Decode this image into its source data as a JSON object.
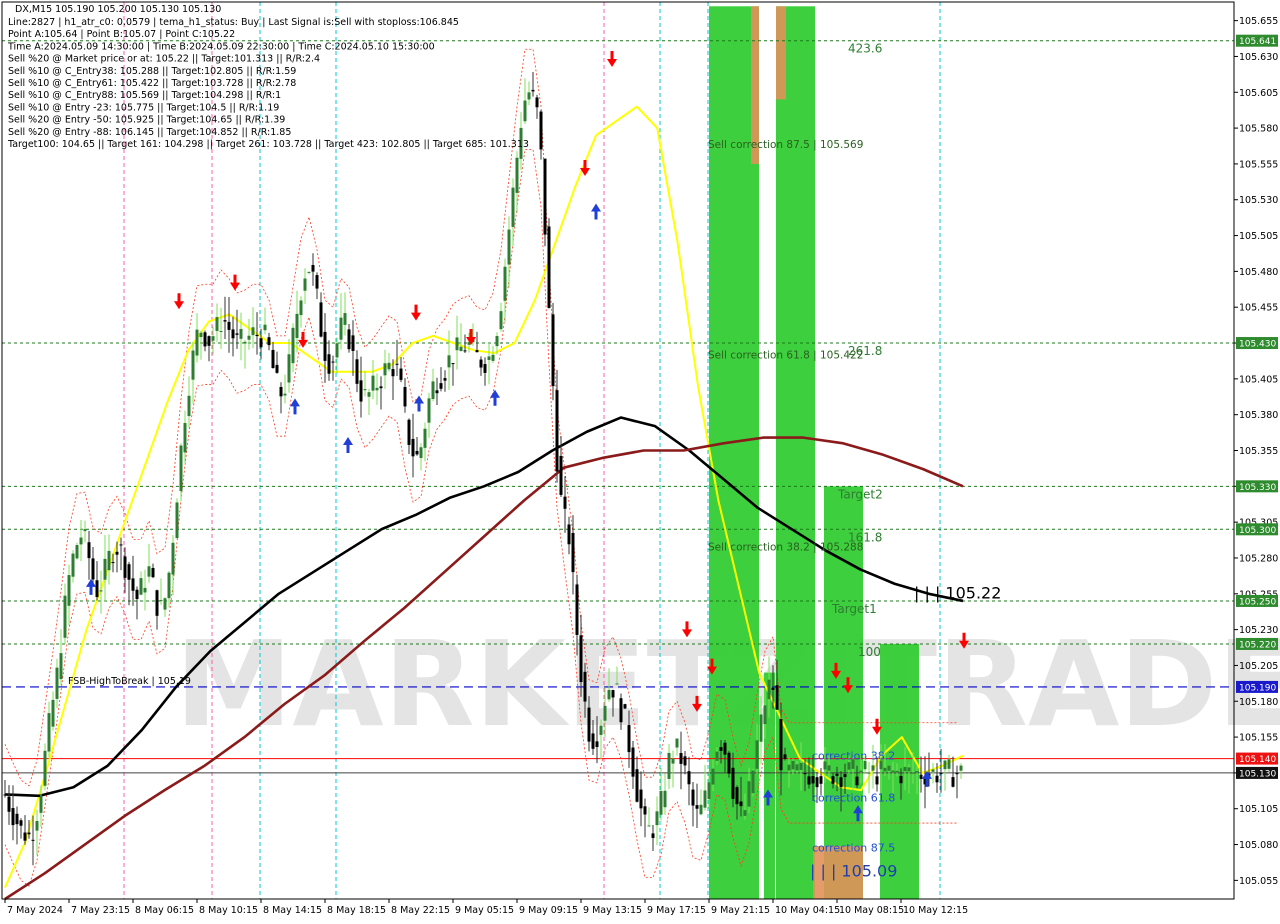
{
  "chart_title": "DX,M15  105.190 105.200 105.130 105.130",
  "info_lines": [
    "Line:2827 | h1_atr_c0: 0.0579 | tema_h1_status: Buy | Last Signal is:Sell with stoploss:106.845",
    "Point A:105.64 | Point B:105.07 | Point C:105.22",
    "Time A:2024.05.09 14:30:00 | Time B:2024.05.09 22:30:00 | Time C:2024.05.10 15:30:00",
    "Sell %20 @ Market price or at: 105.22 || Target:101.313 || R/R:2.4",
    "Sell %10 @ C_Entry38: 105.288 || Target:102.805 || R/R:1.59",
    "Sell %10 @ C_Entry61: 105.422 || Target:103.728 || R/R:2.78",
    "Sell %10 @ C_Entry88: 105.569 || Target:104.298 || R/R:1",
    "Sell %10 @ Entry -23: 105.775 || Target:104.5 || R/R:1.19",
    "Sell %20 @ Entry -50: 105.925 || Target:104.65 || R/R:1.39",
    "Sell %20 @ Entry -88: 106.145 || Target:104.852 || R/R:1.85",
    "Target100: 104.65 || Target 161: 104.298 || Target 261: 103.728 || Target 423: 102.805 || Target 685: 101.313"
  ],
  "watermark": "MARKETZITRADE",
  "colors": {
    "background": "#ffffff",
    "plot_background": "#d9d9d9",
    "bull_candle": "#2e7d32",
    "bear_candle": "#000000",
    "wick_green": "#7ee05a",
    "tema_yellow": "#ffff00",
    "ma_black": "#000000",
    "ma_darkred": "#8b1a1a",
    "envelope_red": "#ff3b1f",
    "zone_green": "#33cc33",
    "zone_orange": "#e0915a",
    "level_green": "#1b7a1b",
    "fsb_blue": "#0000cc",
    "current_red": "#ff0000",
    "current_gray": "#808080",
    "vline_cyan": "#00c8d7",
    "vline_pink": "#ff5ca8"
  },
  "chart_data": {
    "type": "candlestick",
    "symbol": "DX",
    "timeframe": "M15",
    "ohlc_last": {
      "open": 105.19,
      "high": 105.2,
      "low": 105.13,
      "close": 105.13
    },
    "y_range": [
      105.042,
      105.668
    ],
    "y_ticks": [
      "105.655",
      "105.630",
      "105.605",
      "105.580",
      "105.555",
      "105.530",
      "105.505",
      "105.480",
      "105.455",
      "105.430",
      "105.405",
      "105.380",
      "105.355",
      "105.330",
      "105.305",
      "105.280",
      "105.255",
      "105.230",
      "105.205",
      "105.180",
      "105.155",
      "105.130",
      "105.105",
      "105.080",
      "105.055"
    ],
    "x_ticks": [
      "7 May 2024",
      "7 May 23:15",
      "8 May 06:15",
      "8 May 10:15",
      "8 May 14:15",
      "8 May 18:15",
      "8 May 22:15",
      "9 May 05:15",
      "9 May 09:15",
      "9 May 13:15",
      "9 May 17:15",
      "9 May 21:15",
      "10 May 04:15",
      "10 May 08:15",
      "10 May 12:15"
    ],
    "x_tick_index": [
      0,
      64,
      128,
      192,
      256,
      320,
      384,
      448,
      512,
      576,
      640,
      704,
      768,
      832,
      896
    ],
    "candle_step_px": 1,
    "price_levels": [
      {
        "price": 105.641,
        "label": "423.6",
        "tag": "105.641",
        "color": "#1b7a1b"
      },
      {
        "price": 105.43,
        "label": "261.8",
        "tag": "105.430",
        "color": "#1b7a1b"
      },
      {
        "price": 105.33,
        "label": "Target2",
        "tag": "105.330",
        "color": "#1b7a1b"
      },
      {
        "price": 105.3,
        "label": "161.8",
        "tag": "105.300",
        "color": "#1b7a1b"
      },
      {
        "price": 105.25,
        "label": "Target1",
        "tag": "105.250",
        "color": "#1b7a1b"
      },
      {
        "price": 105.22,
        "label": "100",
        "tag": "105.220",
        "color": "#1b7a1b"
      }
    ],
    "fsb_line": {
      "price": 105.19,
      "label": "FSB-HighToBreak | 105.19",
      "tag": "105.190"
    },
    "current_lines": [
      {
        "price": 105.14,
        "tag": "105.140",
        "color": "#ff0000"
      },
      {
        "price": 105.13,
        "tag": "105.130",
        "color": "#404040"
      }
    ],
    "sell_corrections": [
      {
        "price": 105.569,
        "label": "Sell correction 87.5 | 105.569"
      },
      {
        "price": 105.422,
        "label": "Sell correction 61.8 | 105.422"
      },
      {
        "price": 105.288,
        "label": "Sell correction 38.2 | 105.288"
      }
    ],
    "buy_corrections": [
      {
        "price": 105.142,
        "label": "correction 38.2"
      },
      {
        "price": 105.113,
        "label": "correction 61.8"
      },
      {
        "price": 105.078,
        "label": "correction 87.5"
      }
    ],
    "annotations": [
      {
        "text": "| | | 105.22",
        "price": 105.256,
        "style": "black"
      },
      {
        "text": "| | | 105.09",
        "price": 105.062,
        "style": "blue"
      }
    ],
    "series": [
      {
        "kind": "close",
        "closes": [
          105.115,
          105.108,
          105.102,
          105.096,
          105.09,
          105.088,
          105.086,
          105.092,
          105.104,
          105.12,
          105.142,
          105.162,
          105.18,
          105.198,
          105.222,
          105.246,
          105.266,
          105.28,
          105.29,
          105.296,
          105.291,
          105.28,
          105.266,
          105.258,
          105.262,
          105.27,
          105.28,
          105.286,
          105.288,
          105.284,
          105.276,
          105.266,
          105.258,
          105.252,
          105.258,
          105.266,
          105.271,
          105.26,
          105.248,
          105.244,
          105.252,
          105.27,
          105.296,
          105.326,
          105.356,
          105.382,
          105.403,
          105.42,
          105.435,
          105.44,
          105.436,
          105.432,
          105.436,
          105.44,
          105.446,
          105.445,
          105.44,
          105.435,
          105.43,
          105.43,
          105.432,
          105.434,
          105.436,
          105.436,
          105.436,
          105.433,
          105.425,
          105.412,
          105.4,
          105.395,
          105.4,
          105.414,
          105.434,
          105.452,
          105.468,
          105.48,
          105.483,
          105.475,
          105.46,
          105.44,
          105.425,
          105.418,
          105.42,
          105.43,
          105.44,
          105.442,
          105.434,
          105.42,
          105.406,
          105.396,
          105.392,
          105.394,
          105.398,
          105.402,
          105.406,
          105.411,
          105.414,
          105.414,
          105.41,
          105.397,
          105.378,
          105.364,
          105.354,
          105.35,
          105.358,
          105.374,
          105.39,
          105.4,
          105.405,
          105.408,
          105.412,
          105.418,
          105.422,
          105.424,
          105.426,
          105.428,
          105.428,
          105.424,
          105.42,
          105.418,
          105.418,
          105.42,
          105.43,
          105.442,
          105.46,
          105.485,
          105.51,
          105.535,
          105.56,
          105.585,
          105.6,
          105.605,
          105.6,
          105.59,
          105.56,
          105.51,
          105.45,
          105.4,
          105.35,
          105.32,
          105.305,
          105.295,
          105.262,
          105.228,
          105.2,
          105.178,
          105.16,
          105.155,
          105.158,
          105.168,
          105.182,
          105.19,
          105.19,
          105.185,
          105.175,
          105.165,
          105.15,
          105.135,
          105.118,
          105.104,
          105.092,
          105.09,
          105.092,
          105.098,
          105.108,
          105.124,
          105.138,
          105.145,
          105.145,
          105.14,
          105.13,
          105.118,
          105.106,
          105.1,
          105.104,
          105.112,
          105.124,
          105.14,
          105.15,
          105.152,
          105.146,
          105.136,
          105.12,
          105.108,
          105.1,
          105.104,
          105.116,
          105.132,
          105.15,
          105.165,
          105.18,
          105.19,
          105.19,
          105.17,
          105.14,
          105.13
        ],
        "note": "compressed close path (every 4 bars) — renderer expands it"
      },
      {
        "name": "TEMA",
        "color": "#ffff00",
        "values": [
          105.05,
          105.082,
          105.13,
          105.18,
          105.23,
          105.27,
          105.31,
          105.35,
          105.39,
          105.425,
          105.445,
          105.45,
          105.44,
          105.43,
          105.43,
          105.42,
          105.41,
          105.41,
          105.41,
          105.415,
          105.43,
          105.435,
          105.43,
          105.425,
          105.423,
          105.43,
          105.46,
          105.5,
          105.54,
          105.575,
          105.585,
          105.595,
          105.58,
          105.5,
          105.4,
          105.32,
          105.26,
          105.2,
          105.17,
          105.14,
          105.13,
          105.12,
          105.118,
          105.142,
          105.155,
          105.13,
          105.135,
          105.142
        ]
      },
      {
        "name": "MA-fast",
        "color": "#000000",
        "values": [
          105.115,
          105.114,
          105.12,
          105.135,
          105.16,
          105.19,
          105.215,
          105.235,
          105.255,
          105.27,
          105.285,
          105.3,
          105.31,
          105.322,
          105.33,
          105.34,
          105.355,
          105.368,
          105.378,
          105.372,
          105.355,
          105.335,
          105.315,
          105.3,
          105.285,
          105.272,
          105.262,
          105.255,
          105.25
        ]
      },
      {
        "name": "MA-slow",
        "color": "#8b1a1a",
        "values": [
          105.042,
          105.06,
          105.08,
          105.1,
          105.118,
          105.135,
          105.155,
          105.178,
          105.198,
          105.222,
          105.245,
          105.27,
          105.295,
          105.32,
          105.343,
          105.35,
          105.355,
          105.355,
          105.36,
          105.364,
          105.364,
          105.36,
          105.352,
          105.342,
          105.33
        ]
      }
    ],
    "zones": [
      {
        "kind": "green",
        "from_idx": 704,
        "to_idx": 754,
        "top": 105.665,
        "bottom": 105.042
      },
      {
        "kind": "orange",
        "from_idx": 746,
        "to_idx": 754,
        "top": 105.665,
        "bottom": 105.555
      },
      {
        "kind": "green",
        "from_idx": 759,
        "to_idx": 770,
        "top": 105.2,
        "bottom": 105.042
      },
      {
        "kind": "green",
        "from_idx": 771,
        "to_idx": 810,
        "top": 105.665,
        "bottom": 105.042
      },
      {
        "kind": "orange",
        "from_idx": 771,
        "to_idx": 781,
        "top": 105.665,
        "bottom": 105.6
      },
      {
        "kind": "green",
        "from_idx": 819,
        "to_idx": 858,
        "top": 105.33,
        "bottom": 105.042
      },
      {
        "kind": "orange",
        "from_idx": 808,
        "to_idx": 858,
        "top": 105.079,
        "bottom": 105.042
      },
      {
        "kind": "green",
        "from_idx": 875,
        "to_idx": 914,
        "top": 105.22,
        "bottom": 105.042
      }
    ],
    "signal_arrows": [
      {
        "dir": "down",
        "idx": 174,
        "price": 105.455
      },
      {
        "dir": "down",
        "idx": 230,
        "price": 105.468
      },
      {
        "dir": "down",
        "idx": 298,
        "price": 105.428
      },
      {
        "dir": "down",
        "idx": 411,
        "price": 105.447
      },
      {
        "dir": "down",
        "idx": 466,
        "price": 105.43
      },
      {
        "dir": "down",
        "idx": 580,
        "price": 105.548
      },
      {
        "dir": "down",
        "idx": 607,
        "price": 105.624
      },
      {
        "dir": "down",
        "idx": 682,
        "price": 105.226
      },
      {
        "dir": "down",
        "idx": 707,
        "price": 105.2
      },
      {
        "dir": "down",
        "idx": 692,
        "price": 105.174
      },
      {
        "dir": "down",
        "idx": 831,
        "price": 105.197
      },
      {
        "dir": "down",
        "idx": 843,
        "price": 105.187
      },
      {
        "dir": "down",
        "idx": 872,
        "price": 105.158
      },
      {
        "dir": "down",
        "idx": 959,
        "price": 105.218
      },
      {
        "dir": "up",
        "idx": 86,
        "price": 105.264
      },
      {
        "dir": "up",
        "idx": 290,
        "price": 105.39
      },
      {
        "dir": "up",
        "idx": 343,
        "price": 105.363
      },
      {
        "dir": "up",
        "idx": 414,
        "price": 105.392
      },
      {
        "dir": "up",
        "idx": 490,
        "price": 105.396
      },
      {
        "dir": "up",
        "idx": 591,
        "price": 105.526
      },
      {
        "dir": "up",
        "idx": 763,
        "price": 105.117
      },
      {
        "dir": "up",
        "idx": 853,
        "price": 105.106
      },
      {
        "dir": "up",
        "idx": 922,
        "price": 105.13
      }
    ],
    "v_lines": [
      {
        "idx": 119,
        "color": "#ff5ca8"
      },
      {
        "idx": 207,
        "color": "#ff5ca8"
      },
      {
        "idx": 255,
        "color": "#00c8d7"
      },
      {
        "idx": 331,
        "color": "#00c8d7"
      },
      {
        "idx": 599,
        "color": "#ff5ca8"
      },
      {
        "idx": 655,
        "color": "#00c8d7"
      },
      {
        "idx": 703,
        "color": "#00c8d7"
      },
      {
        "idx": 935,
        "color": "#00c8d7"
      }
    ]
  }
}
